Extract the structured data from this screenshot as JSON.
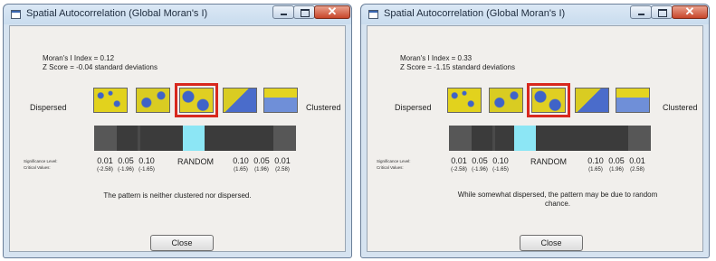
{
  "windows": [
    {
      "title": "Spatial Autocorrelation (Global Moran's I)",
      "morans_i": "Moran's I Index = 0.12",
      "z_score": "Z Score = -0.04 standard deviations",
      "dispersed_label": "Dispersed",
      "clustered_label": "Clustered",
      "significance_caption": [
        "Significance Level:",
        "Critical Values:"
      ],
      "significance_left": [
        "0.01",
        "0.05",
        "0.10"
      ],
      "critical_left": [
        "(-2.58)",
        "(-1.96)",
        "(-1.65)"
      ],
      "random_label": "RANDOM",
      "significance_right": [
        "0.10",
        "0.05",
        "0.01"
      ],
      "critical_right": [
        "(1.65)",
        "(1.96)",
        "(2.58)"
      ],
      "message": "The pattern is neither clustered nor dispersed.",
      "close_label": "Close",
      "selected_thumbnail": 3
    },
    {
      "title": "Spatial Autocorrelation (Global Moran's I)",
      "morans_i": "Moran's I Index = 0.33",
      "z_score": "Z Score = -1.15 standard deviations",
      "dispersed_label": "Dispersed",
      "clustered_label": "Clustered",
      "significance_caption": [
        "Significance Level:",
        "Critical Values:"
      ],
      "significance_left": [
        "0.01",
        "0.05",
        "0.10"
      ],
      "critical_left": [
        "(-2.58)",
        "(-1.96)",
        "(-1.65)"
      ],
      "random_label": "RANDOM",
      "significance_right": [
        "0.10",
        "0.05",
        "0.01"
      ],
      "critical_right": [
        "(1.65)",
        "(1.96)",
        "(2.58)"
      ],
      "message": "While somewhat dispersed, the pattern may be due to random chance.",
      "close_label": "Close",
      "selected_thumbnail": 3
    }
  ],
  "colors": {
    "selection_outline": "#d8281e",
    "z_score_marker": "#8ce6f5",
    "bar_dark": "#3b3b3b"
  },
  "icons": {
    "window_icon": "window-icon",
    "minimize": "minimize-icon",
    "maximize": "maximize-icon",
    "close": "close-icon"
  }
}
